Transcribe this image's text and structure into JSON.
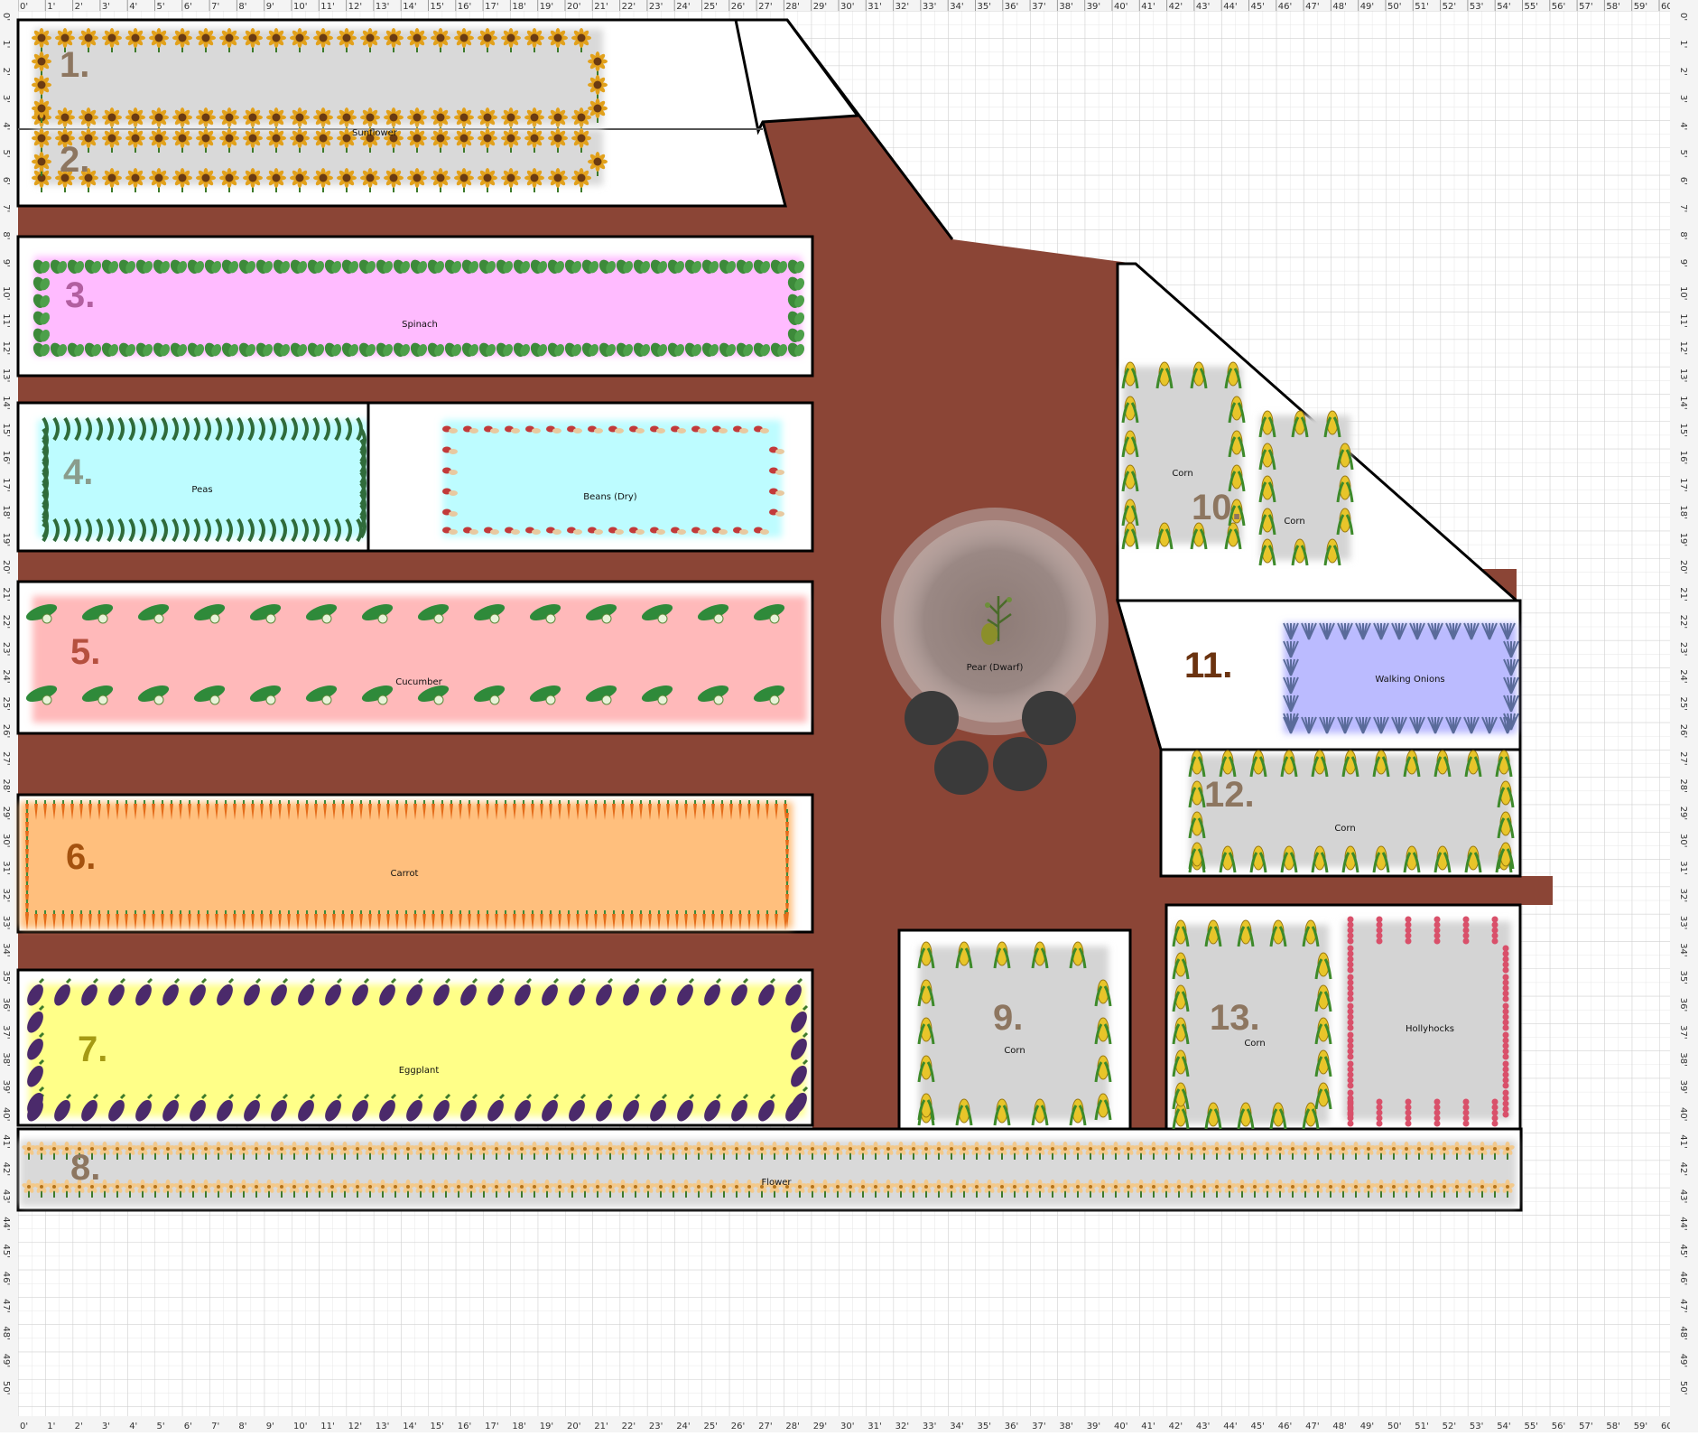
{
  "canvas_title": "",
  "colors": {
    "path": "#8B4536",
    "grid_minor": "#e4e4e4",
    "grid_major": "#c8c8c8",
    "bed_outline": "#000000",
    "sunflower": "#d9d9d9",
    "spinach": "#ffbbff",
    "peas": "#bdfcff",
    "beans": "#bdfcff",
    "cucumber": "#ffb9ba",
    "carrot": "#ffbf7d",
    "eggplant": "#ffff88",
    "corn": "#d4d4d4",
    "onion": "#bbbbff",
    "hollyhock": "#d4d4d4"
  },
  "ruler": {
    "x_labels": [
      "0'",
      "1'",
      "2'",
      "3'",
      "4'",
      "5'",
      "6'",
      "7'",
      "8'",
      "9'",
      "10'",
      "11'",
      "12'",
      "13'",
      "14'",
      "15'",
      "16'",
      "17'",
      "18'",
      "19'",
      "20'",
      "21'",
      "22'",
      "23'",
      "24'",
      "25'",
      "26'",
      "27'",
      "28'",
      "29'",
      "30'",
      "31'",
      "32'",
      "33'",
      "34'",
      "35'",
      "36'",
      "37'",
      "38'",
      "39'",
      "40'",
      "41'",
      "42'",
      "43'",
      "44'",
      "45'",
      "46'",
      "47'",
      "48'",
      "49'",
      "50'",
      "51'",
      "52'",
      "53'",
      "54'",
      "55'",
      "56'",
      "57'",
      "58'",
      "59'",
      "60'"
    ],
    "y_labels": [
      "0'",
      "1'",
      "2'",
      "3'",
      "4'",
      "5'",
      "6'",
      "7'",
      "8'",
      "9'",
      "10'",
      "11'",
      "12'",
      "13'",
      "14'",
      "15'",
      "16'",
      "17'",
      "18'",
      "19'",
      "20'",
      "21'",
      "22'",
      "23'",
      "24'",
      "25'",
      "26'",
      "27'",
      "28'",
      "29'",
      "30'",
      "31'",
      "32'",
      "33'",
      "34'",
      "35'",
      "36'",
      "37'",
      "38'",
      "39'",
      "40'",
      "41'",
      "42'",
      "43'",
      "44'",
      "45'",
      "46'",
      "47'",
      "48'",
      "49'",
      "50'"
    ]
  },
  "beds": [
    {
      "number": "1.",
      "plant": "",
      "color_key": "sunflower",
      "num_color": "#8d7660",
      "icon": "sunflower-icon"
    },
    {
      "number": "2.",
      "plant": "Sunflower",
      "color_key": "sunflower",
      "num_color": "#8d7660",
      "icon": "sunflower-icon"
    },
    {
      "number": "3.",
      "plant": "Spinach",
      "color_key": "spinach",
      "num_color": "#b25fa0",
      "icon": "spinach-icon"
    },
    {
      "number": "4.",
      "plant": "Peas",
      "color_key": "peas",
      "num_color": "#8a9c8c",
      "icon": "pea-pod-icon"
    },
    {
      "number": "",
      "plant": "Beans (Dry)",
      "color_key": "beans",
      "num_color": "#8a9c8c",
      "icon": "bean-icon"
    },
    {
      "number": "5.",
      "plant": "Cucumber",
      "color_key": "cucumber",
      "num_color": "#b5503f",
      "icon": "cucumber-icon"
    },
    {
      "number": "6.",
      "plant": "Carrot",
      "color_key": "carrot",
      "num_color": "#a4520f",
      "icon": "carrot-icon"
    },
    {
      "number": "7.",
      "plant": "Eggplant",
      "color_key": "eggplant",
      "num_color": "#a59a14",
      "icon": "eggplant-icon"
    },
    {
      "number": "8.",
      "plant": "Flower",
      "color_key": "sunflower",
      "num_color": "#8d7660",
      "icon": "flower-icon"
    },
    {
      "number": "9.",
      "plant": "Corn",
      "color_key": "corn",
      "num_color": "#8d7660",
      "icon": "corn-icon"
    },
    {
      "number": "10.",
      "plant": "Corn",
      "color_key": "corn",
      "num_color": "#8d7660",
      "icon": "corn-icon"
    },
    {
      "number": "",
      "plant": "Corn",
      "color_key": "corn",
      "num_color": "#8d7660",
      "icon": "corn-icon"
    },
    {
      "number": "11.",
      "plant": "Walking Onions",
      "color_key": "onion",
      "num_color": "#6b3310",
      "icon": "onion-icon"
    },
    {
      "number": "12.",
      "plant": "Corn",
      "color_key": "corn",
      "num_color": "#8d7660",
      "icon": "corn-icon"
    },
    {
      "number": "13.",
      "plant": "Corn",
      "color_key": "corn",
      "num_color": "#8d7660",
      "icon": "corn-icon"
    },
    {
      "number": "",
      "plant": "Hollyhocks",
      "color_key": "hollyhock",
      "num_color": "#8d7660",
      "icon": "hollyhock-icon"
    }
  ],
  "tree": {
    "label": "Pear (Dwarf)",
    "icon": "pear-tree-icon"
  },
  "stones": {
    "icon": "stepping-stone-icon"
  }
}
